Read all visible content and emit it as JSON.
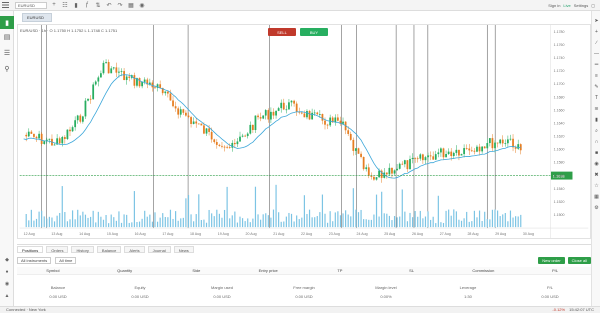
{
  "toolbar": {
    "search_value": "EURUSD",
    "right_items": [
      "Sign in",
      "Live",
      "Settings"
    ]
  },
  "chart": {
    "tab_label": "EURUSD",
    "legend": "EUR/USD · 1h · O 1.1750 H 1.1752 L 1.1748 C 1.1751",
    "sell_label": "SELL",
    "buy_label": "BUY",
    "price_labels": [
      "1.1780",
      "1.1760",
      "1.1740",
      "1.1720",
      "1.1700",
      "1.1680",
      "1.1660",
      "1.1640",
      "1.1620",
      "1.1600",
      "1.1580",
      "1.1560",
      "1.1540",
      "1.1520",
      "1.1500"
    ],
    "current_price": "1.1638",
    "date_labels": [
      "12 Aug",
      "13 Aug",
      "14 Aug",
      "15 Aug",
      "16 Aug",
      "17 Aug",
      "18 Aug",
      "19 Aug",
      "20 Aug",
      "21 Aug",
      "22 Aug",
      "23 Aug",
      "24 Aug",
      "25 Aug",
      "26 Aug",
      "27 Aug",
      "28 Aug",
      "29 Aug",
      "30 Aug"
    ],
    "colors": {
      "up": "#27ae60",
      "down": "#e67e22",
      "ma": "#3aa6d9",
      "price_line": "#2e9e48"
    }
  },
  "panel": {
    "tabs": [
      "Positions",
      "Orders",
      "History",
      "Balance",
      "Alerts",
      "Journal",
      "News"
    ],
    "filter_value": "All instruments",
    "range_value": "All time",
    "new_order_label": "New order",
    "close_all_label": "Close all",
    "columns": [
      "Symbol",
      "Quantity",
      "Side",
      "Entry price",
      "TP",
      "SL",
      "Commission",
      "P/L"
    ],
    "summary1": [
      "Balance",
      "Equity",
      "Margin used",
      "Free margin",
      "Margin level",
      "Leverage",
      "P/L"
    ],
    "summary2": [
      "0.00 USD",
      "0.00 USD",
      "0.00 USD",
      "0.00 USD",
      "0.00%",
      "1:30",
      "0.00 USD"
    ]
  },
  "status": {
    "left": "Connected · New York",
    "right": [
      "-0.12%",
      "15:42:07 UTC"
    ]
  }
}
